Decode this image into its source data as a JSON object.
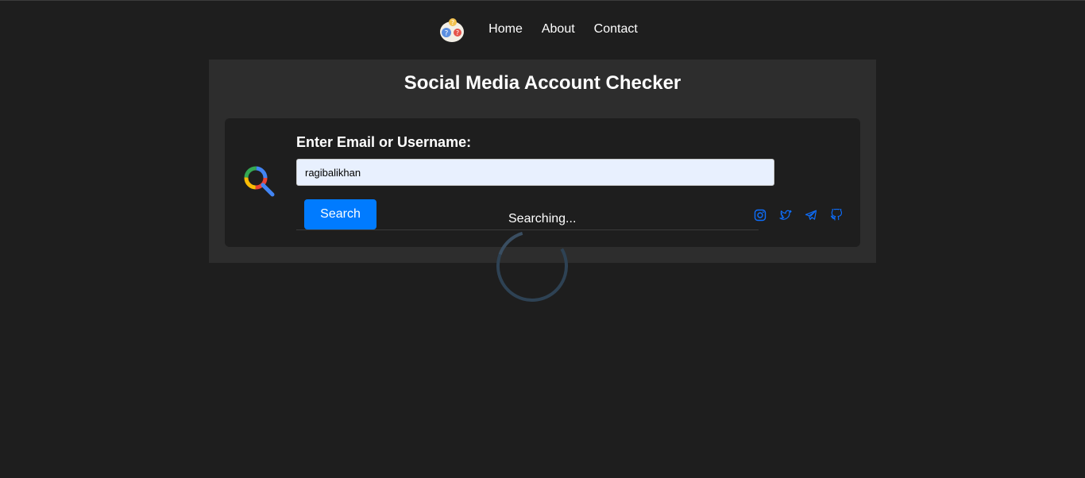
{
  "nav": {
    "logo_icon": "question-bubbles-icon",
    "links": [
      {
        "label": "Home"
      },
      {
        "label": "About"
      },
      {
        "label": "Contact"
      }
    ]
  },
  "panel": {
    "title": "Social Media Account Checker"
  },
  "form": {
    "search_logo_icon": "search-magnifier-icon",
    "label": "Enter Email or Username:",
    "input_value": "ragibalikhan",
    "button_label": "Search",
    "status": "Searching...",
    "socials": [
      "instagram-icon",
      "twitter-icon",
      "telegram-icon",
      "github-icon"
    ]
  },
  "colors": {
    "background": "#1e1e1e",
    "panel": "#2d2d2d",
    "accent": "#007bff",
    "input_bg": "#e8f0fe"
  }
}
